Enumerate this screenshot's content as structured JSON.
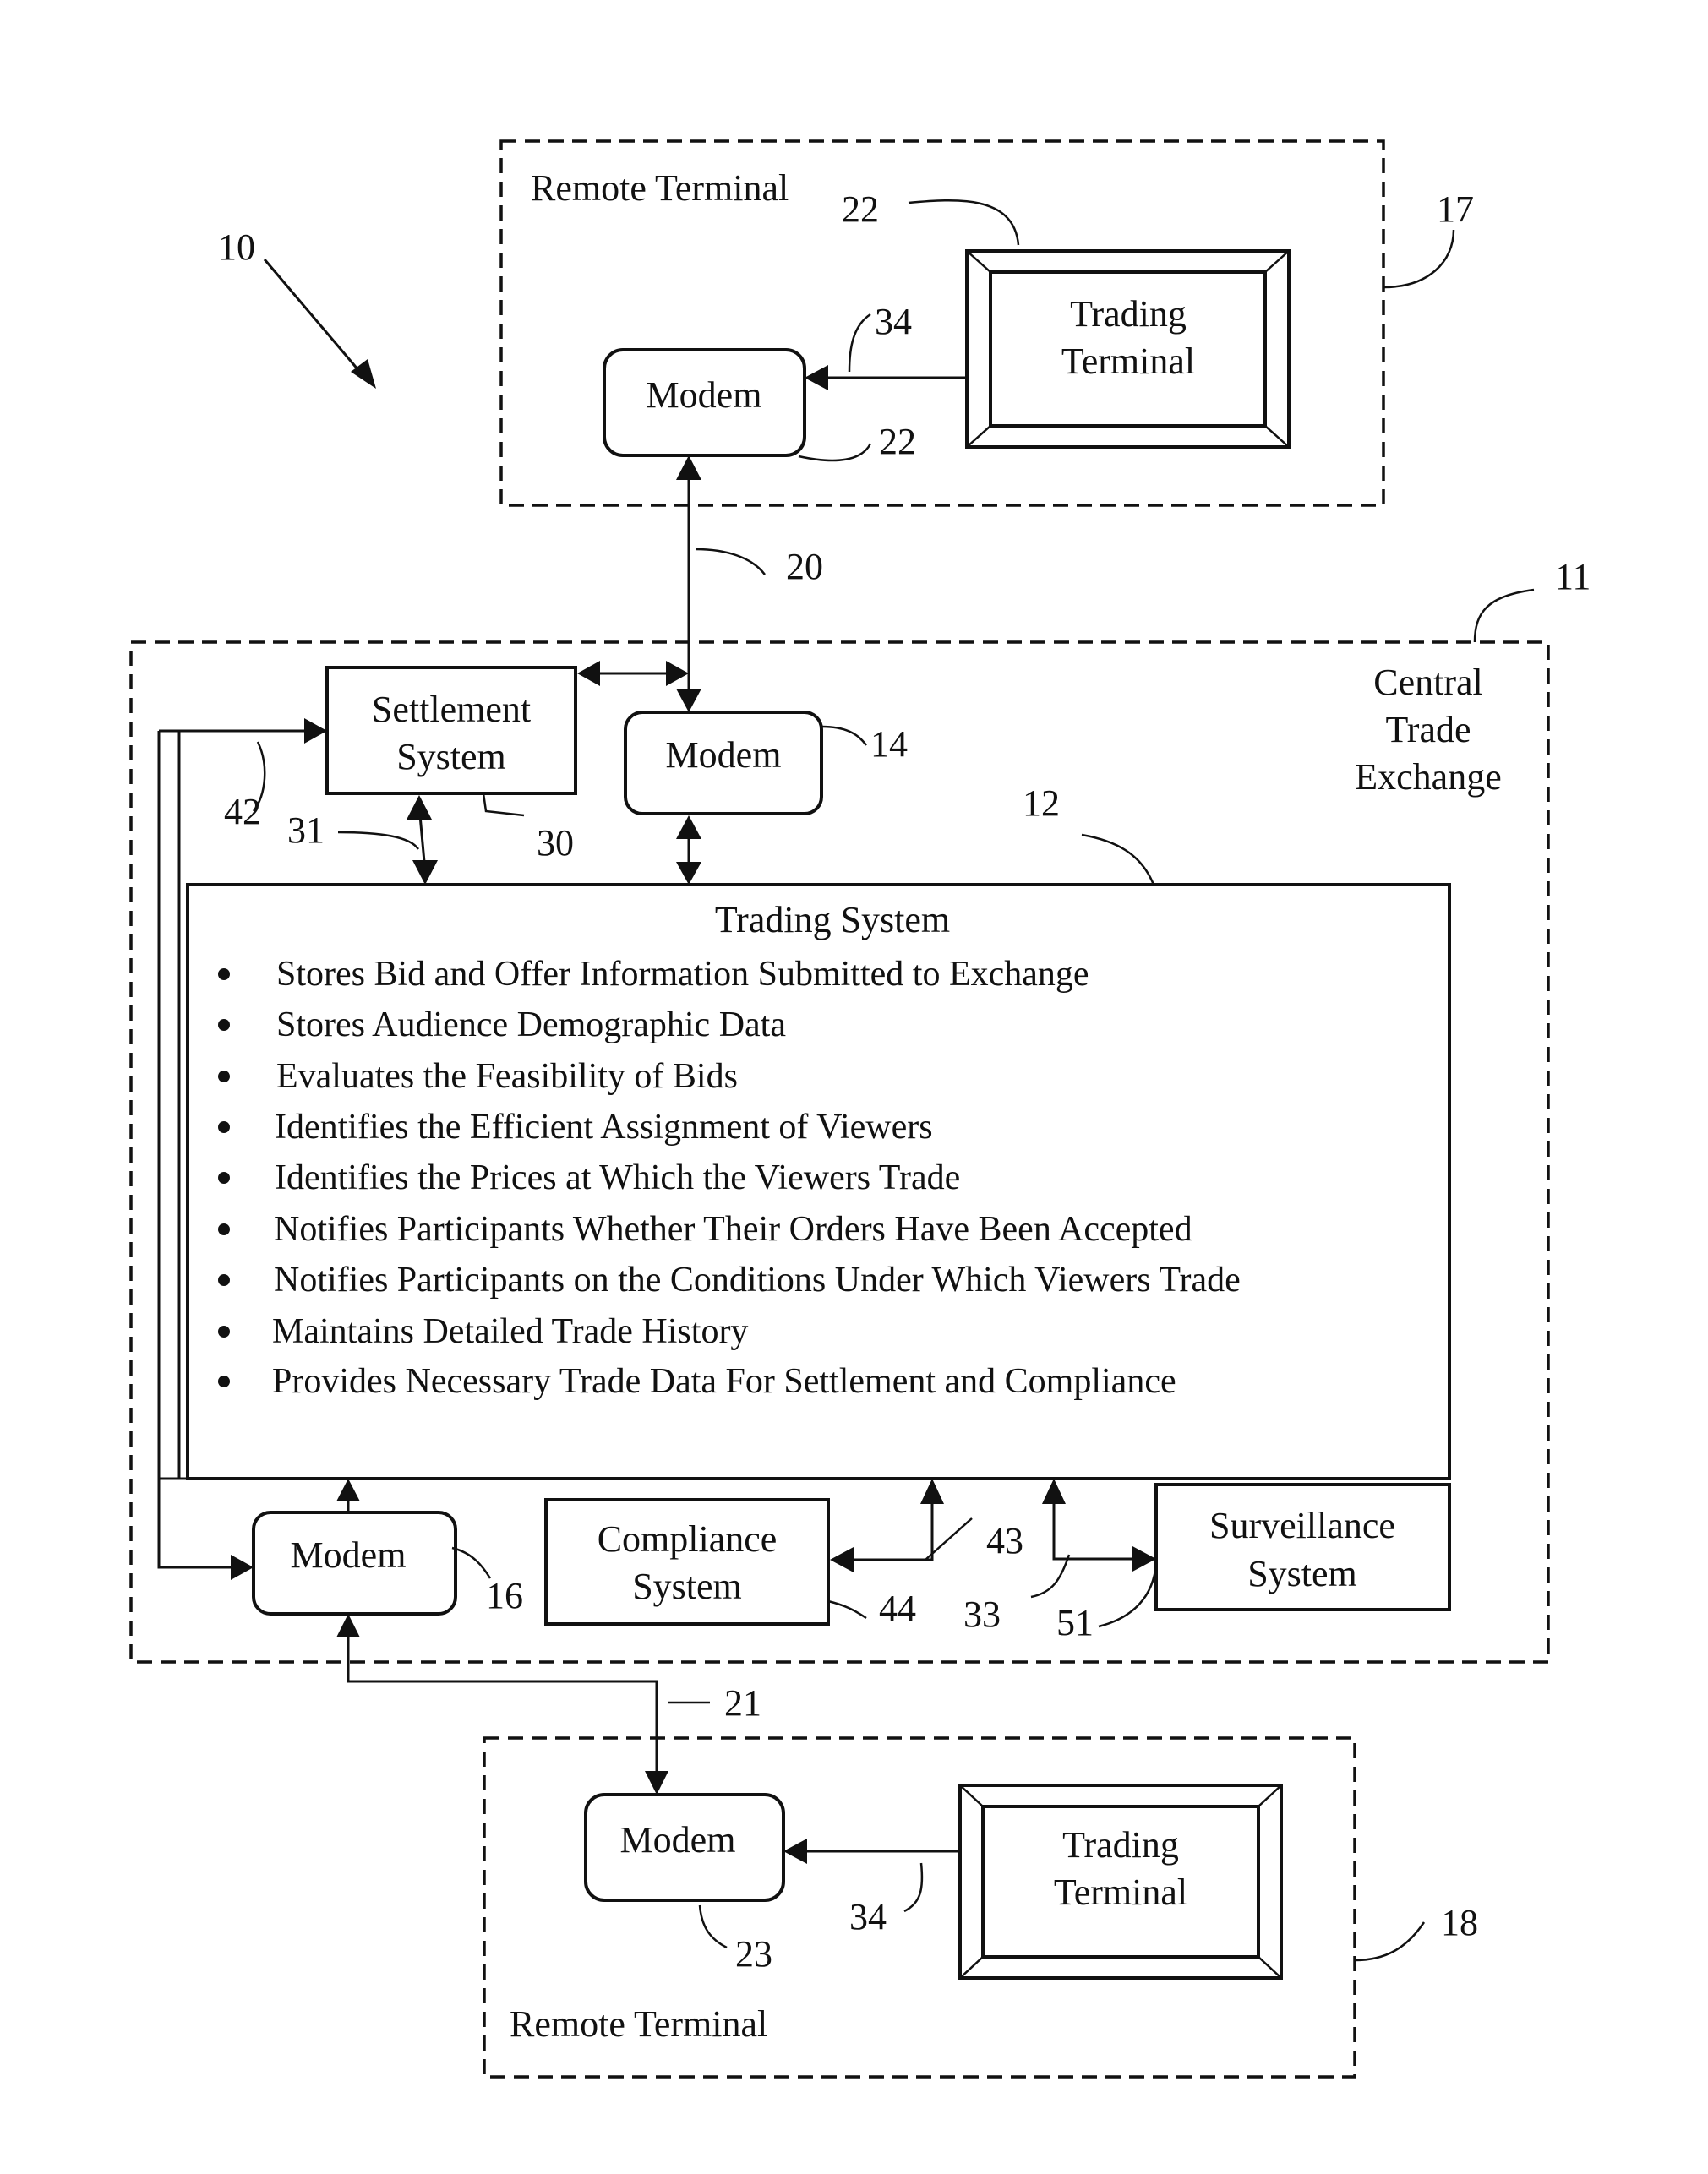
{
  "figure_ref": "10",
  "remote_terminal_top": {
    "label": "Remote Terminal",
    "ref": "17",
    "trading_terminal": {
      "line1": "Trading",
      "line2": "Terminal",
      "ref": "22"
    },
    "modem": {
      "label": "Modem",
      "ref": "22"
    },
    "link_ref": "34"
  },
  "link_top_ref": "20",
  "central_exchange": {
    "line1": "Central",
    "line2": "Trade",
    "line3": "Exchange",
    "ref": "11",
    "settlement": {
      "line1": "Settlement",
      "line2": "System",
      "ref": "30"
    },
    "modem_14": {
      "label": "Modem",
      "ref": "14"
    },
    "ref_31": "31",
    "ref_42": "42",
    "trading_system": {
      "ref": "12",
      "title": "Trading System",
      "bullets": [
        "Stores Bid and Offer Information Submitted to Exchange",
        "Stores Audience Demographic Data",
        "Evaluates the Feasibility of Bids",
        "Identifies the Efficient Assignment of Viewers",
        "Identifies the Prices at Which the Viewers Trade",
        "Notifies Participants Whether Their Orders Have Been Accepted",
        "Notifies Participants on the Conditions Under Which Viewers Trade",
        "Maintains Detailed Trade History",
        "Provides Necessary Trade Data For Settlement and Compliance"
      ]
    },
    "modem_16": {
      "label": "Modem",
      "ref": "16"
    },
    "compliance": {
      "line1": "Compliance",
      "line2": "System",
      "ref": "44"
    },
    "ref_43": "43",
    "ref_33": "33",
    "surveillance": {
      "line1": "Surveillance",
      "line2": "System",
      "ref": "51"
    }
  },
  "link_bottom_ref": "21",
  "remote_terminal_bottom": {
    "label": "Remote Terminal",
    "ref": "18",
    "trading_terminal": {
      "line1": "Trading",
      "line2": "Terminal"
    },
    "modem": {
      "label": "Modem",
      "ref": "23"
    },
    "link_ref": "34"
  }
}
